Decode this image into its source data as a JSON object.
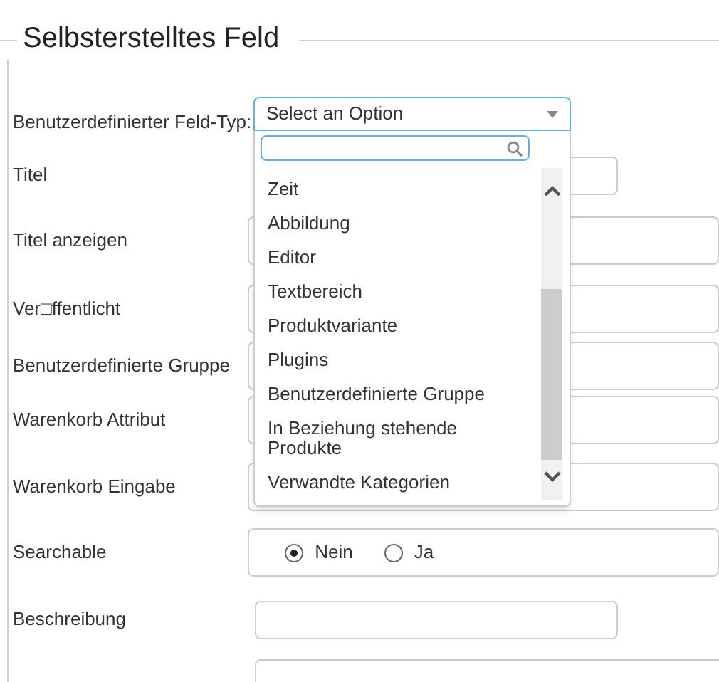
{
  "legend": "Selbsterstelltes Feld",
  "fields": [
    {
      "label": "Benutzerdefinierter Feld-Typ:",
      "kind": "select"
    },
    {
      "label": "Titel",
      "kind": "text"
    },
    {
      "label": "Titel anzeigen",
      "kind": "box"
    },
    {
      "label": "Ver□ffentlicht",
      "kind": "box"
    },
    {
      "label": "Benutzerdefinierte Gruppe",
      "kind": "box"
    },
    {
      "label": "Warenkorb Attribut",
      "kind": "box"
    },
    {
      "label": "Warenkorb Eingabe",
      "kind": "box"
    },
    {
      "label": "Searchable",
      "kind": "radio",
      "options": [
        {
          "label": "Nein",
          "selected": true
        },
        {
          "label": "Ja",
          "selected": false
        }
      ]
    },
    {
      "label": "Beschreibung",
      "kind": "text"
    }
  ],
  "dropdown": {
    "value": "Select an Option",
    "options": [
      "Zeit",
      "Abbildung",
      "Editor",
      "Textbereich",
      "Produktvariante",
      "Plugins",
      "Benutzerdefinierte Gruppe",
      "In Beziehung stehende Produkte",
      "Verwandte Kategorien"
    ]
  }
}
